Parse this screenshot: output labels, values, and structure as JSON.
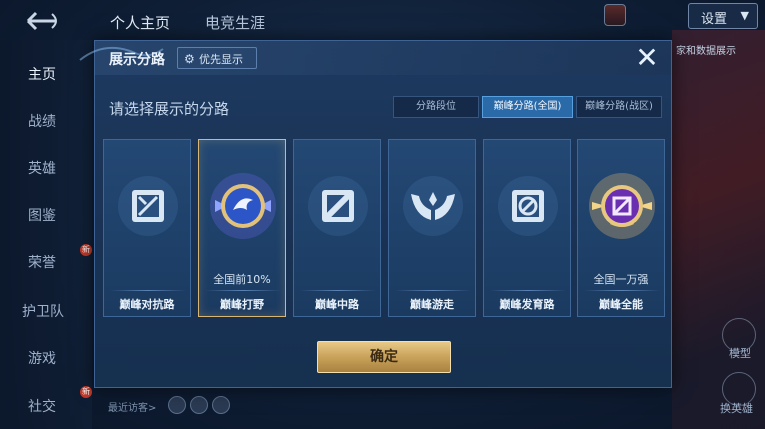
{
  "header_tabs": [
    "个人主页",
    "电竞生涯"
  ],
  "settings": {
    "label": "设置"
  },
  "sidebar": [
    {
      "label": "主页",
      "active": true
    },
    {
      "label": "战绩"
    },
    {
      "label": "英雄"
    },
    {
      "label": "图鉴"
    },
    {
      "label": "荣誉",
      "badge": "新"
    },
    {
      "label": "护卫队"
    },
    {
      "label": "游戏"
    },
    {
      "label": "社交",
      "badge": "新"
    }
  ],
  "right_panel": {
    "text": "家和数据展示",
    "buttons": [
      "模型",
      "换英雄"
    ]
  },
  "recent_visitors": "最近访客>",
  "dialog": {
    "title": "展示分路",
    "priority_label": "优先显示",
    "prompt": "请选择展示的分路",
    "segments": [
      "分路段位",
      "巅峰分路(全国)",
      "巅峰分路(战区)"
    ],
    "active_segment": 1,
    "cards": [
      {
        "name": "巅峰对抗路",
        "rank": "",
        "icon": "clash-lane-icon"
      },
      {
        "name": "巅峰打野",
        "rank": "全国前10%",
        "icon": "jungle-icon",
        "selected": true
      },
      {
        "name": "巅峰中路",
        "rank": "",
        "icon": "mid-lane-icon"
      },
      {
        "name": "巅峰游走",
        "rank": "",
        "icon": "roam-icon"
      },
      {
        "name": "巅峰发育路",
        "rank": "",
        "icon": "farm-lane-icon"
      },
      {
        "name": "巅峰全能",
        "rank": "全国一万强",
        "icon": "all-round-icon"
      }
    ],
    "confirm_label": "确定"
  },
  "colors": {
    "accent_gold": "#d8b676",
    "active_tab": "#2b6aa8",
    "panel": "#1e3a60"
  }
}
